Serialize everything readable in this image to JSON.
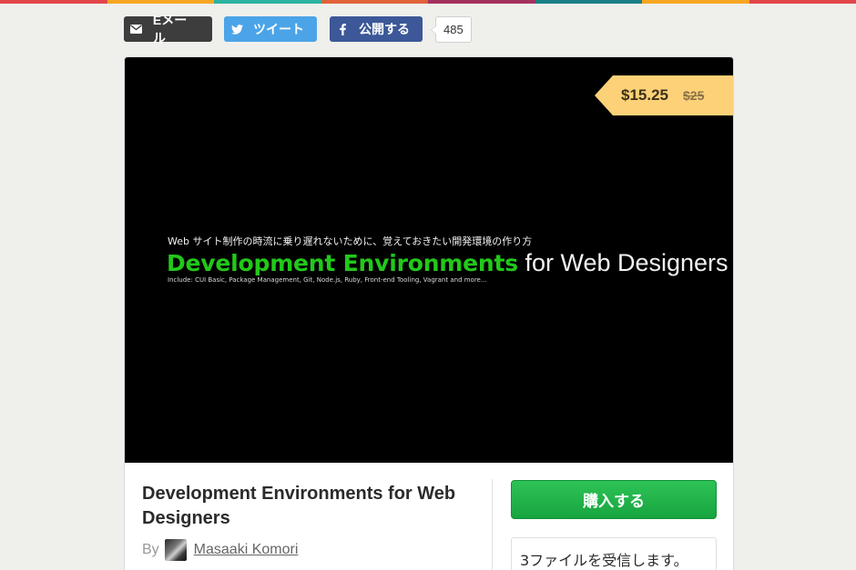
{
  "top_stripe_colors": [
    "#e2464b",
    "#f6a623",
    "#2bb3a0",
    "#e0633a",
    "#a4325e",
    "#1a7f86",
    "#f6a623",
    "#e2464b"
  ],
  "share": {
    "email_label": "Eメール",
    "tweet_label": "ツイート",
    "facebook_label": "公開する",
    "count": "485",
    "colors": {
      "email": "#3d3d3d",
      "tweet": "#4ba4e8",
      "facebook": "#3c5898"
    }
  },
  "cover": {
    "subtitle_jp": "Web サイト制作の時流に乗り遅れないために、覚えておきたい開発環境の作り方",
    "title_green": "Development Environments",
    "title_rest": " for Web Designers",
    "includes": "Include: CUI Basic, Package Management, Git, Node.js, Ruby, Front-end Tooling, Vagrant and more...",
    "accent_color": "#22c81a"
  },
  "price": {
    "current": "$15.25",
    "original": "$25",
    "tag_color": "#fdd178"
  },
  "product": {
    "title": "Development Environments for Web Designers",
    "by_label": "By",
    "author": "Masaaki Komori"
  },
  "purchase": {
    "buy_label": "購入する",
    "files_text": "3ファイルを受信します。",
    "button_color": "#1fb34a"
  }
}
